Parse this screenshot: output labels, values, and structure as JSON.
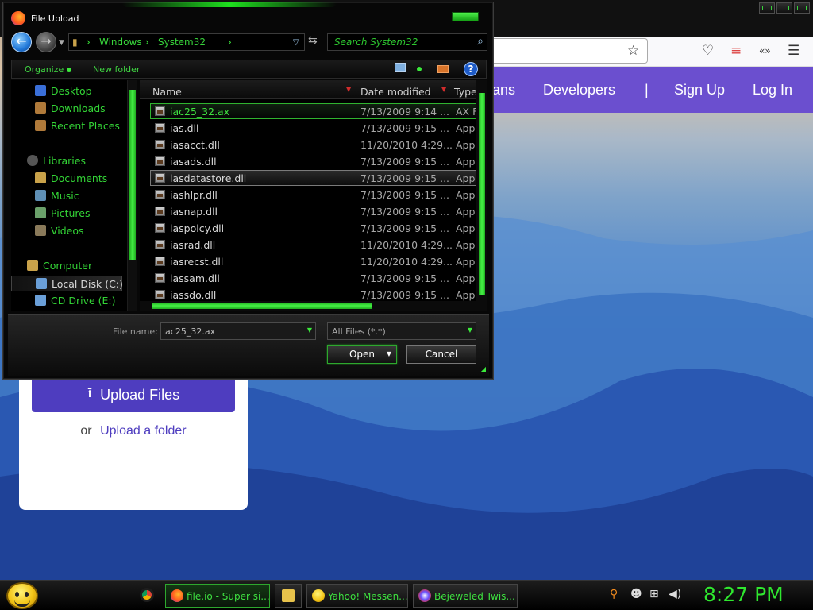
{
  "dialog": {
    "title": "File Upload",
    "breadcrumb": [
      "Windows",
      "System32"
    ],
    "search_placeholder": "Search System32",
    "toolbar": {
      "organize": "Organize",
      "new_folder": "New folder"
    },
    "nav_items": [
      {
        "label": "Desktop",
        "icon": "desktop-icon",
        "color": "#3a6fd8"
      },
      {
        "label": "Downloads",
        "icon": "downloads-icon",
        "color": "#b07a3a"
      },
      {
        "label": "Recent Places",
        "icon": "recent-places-icon",
        "color": "#b07a3a"
      },
      {
        "label": "Libraries",
        "icon": "libraries-icon",
        "color": "#555555"
      },
      {
        "label": "Documents",
        "icon": "documents-icon",
        "color": "#c9a24a"
      },
      {
        "label": "Music",
        "icon": "music-icon",
        "color": "#5f8fb5"
      },
      {
        "label": "Pictures",
        "icon": "pictures-icon",
        "color": "#6aa06a"
      },
      {
        "label": "Videos",
        "icon": "videos-icon",
        "color": "#8a7a5a"
      },
      {
        "label": "Computer",
        "icon": "computer-icon",
        "color": "#c9a24a"
      },
      {
        "label": "Local Disk (C:)",
        "icon": "local-disk-icon",
        "color": "#6a9fd8"
      },
      {
        "label": "CD Drive (E:)",
        "icon": "cd-drive-icon",
        "color": "#6a9fd8"
      }
    ],
    "columns": {
      "name": "Name",
      "date": "Date modified",
      "type": "Type"
    },
    "files": [
      {
        "name": "iac25_32.ax",
        "date": "7/13/2009 9:14 ...",
        "type": "AX F",
        "state": "selected"
      },
      {
        "name": "ias.dll",
        "date": "7/13/2009 9:15 ...",
        "type": "Appli",
        "state": ""
      },
      {
        "name": "iasacct.dll",
        "date": "11/20/2010 4:29...",
        "type": "Appli",
        "state": ""
      },
      {
        "name": "iasads.dll",
        "date": "7/13/2009 9:15 ...",
        "type": "Appli",
        "state": ""
      },
      {
        "name": "iasdatastore.dll",
        "date": "7/13/2009 9:15 ...",
        "type": "Appli",
        "state": "hover"
      },
      {
        "name": "iashlpr.dll",
        "date": "7/13/2009 9:15 ...",
        "type": "Appli",
        "state": ""
      },
      {
        "name": "iasnap.dll",
        "date": "7/13/2009 9:15 ...",
        "type": "Appli",
        "state": ""
      },
      {
        "name": "iaspolcy.dll",
        "date": "7/13/2009 9:15 ...",
        "type": "Appli",
        "state": ""
      },
      {
        "name": "iasrad.dll",
        "date": "11/20/2010 4:29...",
        "type": "Appli",
        "state": ""
      },
      {
        "name": "iasrecst.dll",
        "date": "11/20/2010 4:29...",
        "type": "Appli",
        "state": ""
      },
      {
        "name": "iassam.dll",
        "date": "7/13/2009 9:15 ...",
        "type": "Appli",
        "state": ""
      },
      {
        "name": "iassdo.dll",
        "date": "7/13/2009 9:15 ...",
        "type": "Appli",
        "state": ""
      }
    ],
    "file_name_label": "File name:",
    "file_name_value": "iac25_32.ax",
    "filter_value": "All Files (*.*)",
    "open_label": "Open",
    "cancel_label": "Cancel"
  },
  "site": {
    "nav": [
      "ans",
      "Developers",
      "|",
      "Sign Up",
      "Log In"
    ],
    "upload_button": "Upload Files",
    "or_text": "or",
    "upload_folder": "Upload a folder"
  },
  "taskbar": {
    "tasks": [
      {
        "label": "file.io - Super si...",
        "icon": "firefox-icon",
        "active": true
      },
      {
        "label": "",
        "icon": "folder-icon",
        "active": false
      },
      {
        "label": "Yahoo! Messen...",
        "icon": "yahoo-messenger-icon",
        "active": false
      },
      {
        "label": "Bejeweled Twis...",
        "icon": "bejeweled-icon",
        "active": false
      }
    ],
    "clock": "8:27 PM"
  }
}
